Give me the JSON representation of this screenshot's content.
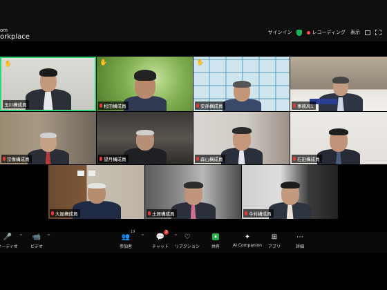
{
  "app": {
    "brand_line1": "om",
    "brand_line2": "orkplace"
  },
  "topbar": {
    "signin": "サインイン",
    "recording": "レコーディング",
    "view": "表示"
  },
  "participants": [
    {
      "name": "玉川構成員",
      "hand_raised": true,
      "active": true
    },
    {
      "name": "松田構成員",
      "hand_raised": true
    },
    {
      "name": "安孫構成員",
      "hand_raised": true
    },
    {
      "name": "事務局1"
    },
    {
      "name": "宗像構成員"
    },
    {
      "name": "望月構成員"
    },
    {
      "name": "森山構成員"
    },
    {
      "name": "石田構成員"
    },
    {
      "name": "大屋構成員"
    },
    {
      "name": "土居構成員"
    },
    {
      "name": "今村構成員"
    }
  ],
  "toolbar": {
    "audio": "オーディオ",
    "video": "ビデオ",
    "participants": "参加者",
    "participants_count": "19",
    "chat": "チャット",
    "chat_badge": "3",
    "reactions": "リアクション",
    "share": "共有",
    "ai": "AI Companion",
    "apps": "アプリ",
    "more": "詳細"
  },
  "colors": {
    "active_speaker": "#2ed573",
    "share_green": "#22b14c",
    "muted_red": "#e03b3b"
  }
}
